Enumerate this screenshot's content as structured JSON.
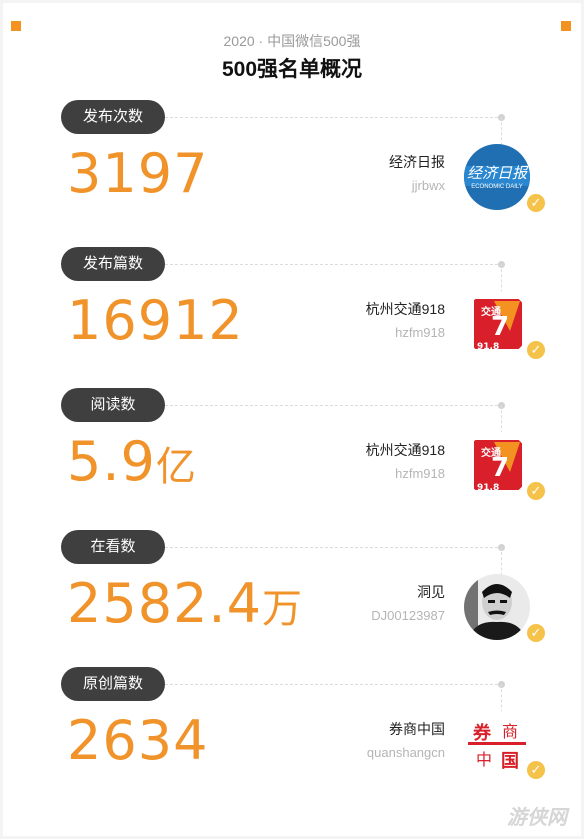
{
  "header": {
    "subtitle": "2020 · 中国微信500强",
    "title": "500强名单概况"
  },
  "stats": [
    {
      "label": "发布次数",
      "value": "3197",
      "unit": "",
      "account_name": "经济日报",
      "account_id": "jjrbwx",
      "avatar_icon": "jingji-ribao-logo"
    },
    {
      "label": "发布篇数",
      "value": "16912",
      "unit": "",
      "account_name": "杭州交通918",
      "account_id": "hzfm918",
      "avatar_icon": "hangzhou-jiaotong-918-logo"
    },
    {
      "label": "阅读数",
      "value": "5.9",
      "unit": "亿",
      "account_name": "杭州交通918",
      "account_id": "hzfm918",
      "avatar_icon": "hangzhou-jiaotong-918-logo"
    },
    {
      "label": "在看数",
      "value": "2582.4",
      "unit": "万",
      "account_name": "洞见",
      "account_id": "DJ00123987",
      "avatar_icon": "dongjian-portrait-avatar"
    },
    {
      "label": "原创篇数",
      "value": "2634",
      "unit": "",
      "account_name": "券商中国",
      "account_id": "quanshangcn",
      "avatar_icon": "quanshang-zhongguo-logo"
    }
  ],
  "logo_text": {
    "jingji": "经济日报",
    "jingji_en": "ECONOMIC DAILY",
    "jiaotong": "交通",
    "freq": "91.8",
    "quanshang_chars": [
      "券",
      "商",
      "中",
      "国"
    ]
  },
  "verified_mark": "✓",
  "watermark": "游侠网",
  "colors": {
    "accent": "#f0932a",
    "pill": "#3f3f3f",
    "verified": "#f5c24a",
    "logo_red": "#d9202a",
    "logo_blue": "#1f6fb2"
  }
}
